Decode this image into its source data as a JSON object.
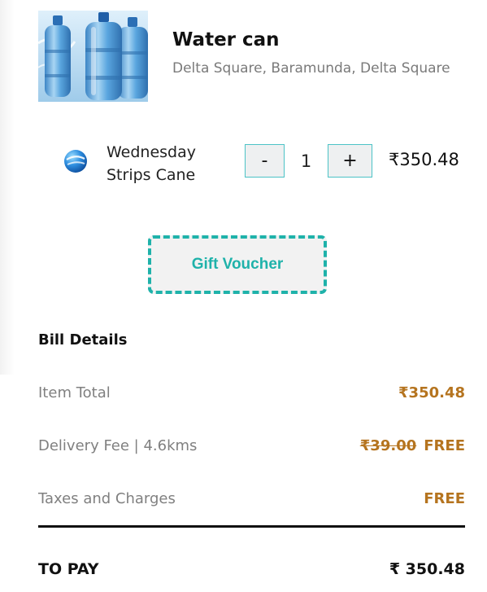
{
  "store": {
    "name": "Water can",
    "address": "Delta Square, Baramunda, Delta Square",
    "image_icon": "water-can-bottles-image"
  },
  "cart_item": {
    "icon": "blue-sphere-logo-icon",
    "name_line1": "Wednesday",
    "name_line2": "Strips Cane",
    "decrement_label": "-",
    "quantity": "1",
    "increment_label": "+",
    "price": "₹350.48"
  },
  "voucher": {
    "label": "Gift Voucher"
  },
  "bill": {
    "title": "Bill Details",
    "rows": [
      {
        "label": "Item Total",
        "value": "₹350.48"
      },
      {
        "label": "Delivery Fee | 4.6kms",
        "original_value": "₹39.00",
        "value": "FREE"
      },
      {
        "label": "Taxes and Charges",
        "value": "FREE"
      }
    ],
    "total_label": "TO PAY",
    "total_value": "₹ 350.48"
  },
  "colors": {
    "accent_teal": "#1fb2aa",
    "stepper_border": "#4cc3c6",
    "price_orange": "#b5741f",
    "muted_gray": "#808080"
  }
}
